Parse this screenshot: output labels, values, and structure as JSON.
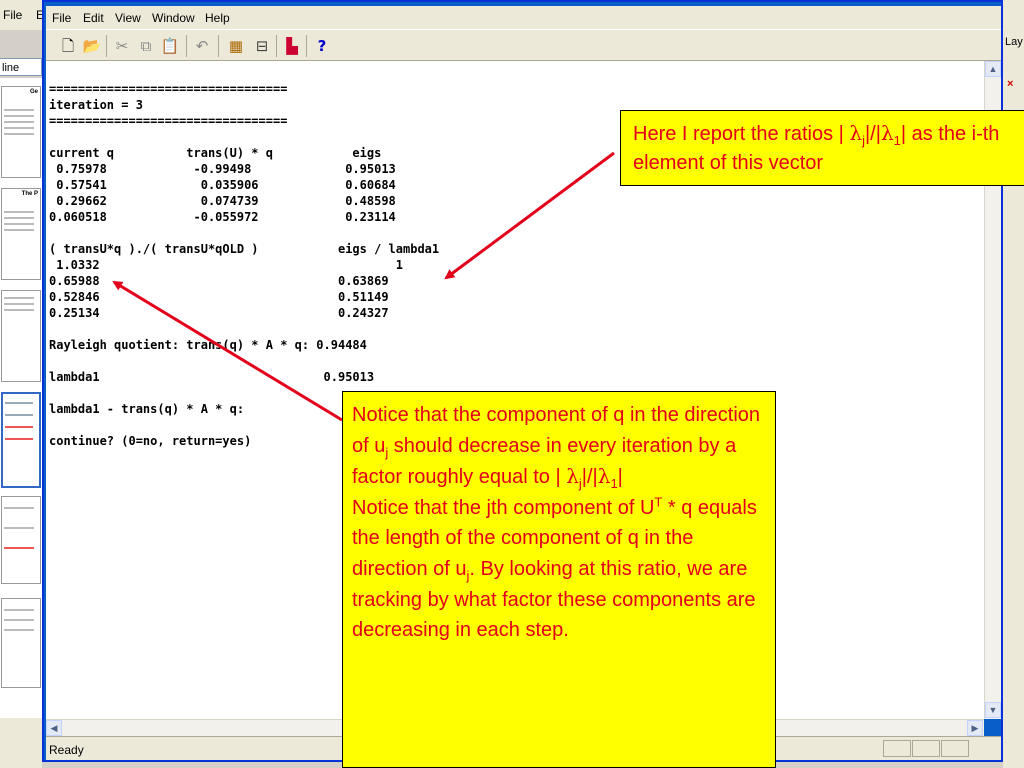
{
  "background_app": {
    "menu": [
      "File",
      "E"
    ],
    "tab_label": "line",
    "slide_titles": [
      "Ge",
      "The P"
    ],
    "right_panel_label": "Lay"
  },
  "window": {
    "menu": [
      "File",
      "Edit",
      "View",
      "Window",
      "Help"
    ],
    "toolbar": {
      "new_icon": "new-file-icon",
      "open_icon": "open-folder-icon",
      "cut_icon": "cut-icon",
      "copy_icon": "copy-icon",
      "paste_icon": "paste-icon",
      "undo_icon": "undo-icon",
      "workspace_icon": "workspace-icon",
      "path_icon": "path-browser-icon",
      "simulink_icon": "simulink-icon",
      "help_label": "?"
    },
    "console_lines": [
      "=================================",
      "iteration = 3",
      "=================================",
      "",
      "current q          trans(U) * q           eigs",
      " 0.75978            -0.99498             0.95013",
      " 0.57541             0.035906            0.60684",
      " 0.29662             0.074739            0.48598",
      "0.060518            -0.055972            0.23114",
      "",
      "( transU*q )./( transU*qOLD )           eigs / lambda1",
      " 1.0332                                         1",
      "0.65988                                 0.63869",
      "0.52846                                 0.51149",
      "0.25134                                 0.24327",
      "",
      "Rayleigh quotient: trans(q) * A * q: 0.94484",
      "",
      "lambda1                               0.95013",
      "",
      "lambda1 - trans(q) * A * q:",
      "",
      "continue? (0=no, return=yes)"
    ],
    "status": "Ready"
  },
  "callout_1": {
    "lead": "Here I report the ratios |",
    "lambda": "λ",
    "sub_j": "j",
    "mid": "|/|",
    "sub_1": "1",
    "tail": "| as the i-th element of this vector"
  },
  "callout_2": {
    "p1_a": "Notice that the component of q in the direction of u",
    "p1_sub_j": "j",
    "p1_b": " should decrease in every iteration by a factor roughly equal to | ",
    "lambda": "λ",
    "p1_sub_j2": "j",
    "p1_mid": "|/|",
    "p1_sub_1": "1",
    "p1_end": "|",
    "p2_a": "Notice that the jth component of U",
    "p2_sup": "T",
    "p2_b": " * q equals the length of the component of q in the direction of u",
    "p2_sub_j": "j",
    "p2_c": ".  By looking at this ratio, we are tracking by what factor these components are decreasing in each step."
  },
  "colors": {
    "callout_bg": "#ffff00",
    "callout_text": "#e3001b",
    "arrow": "#e3001b",
    "xp_blue": "#0a5ec9"
  }
}
